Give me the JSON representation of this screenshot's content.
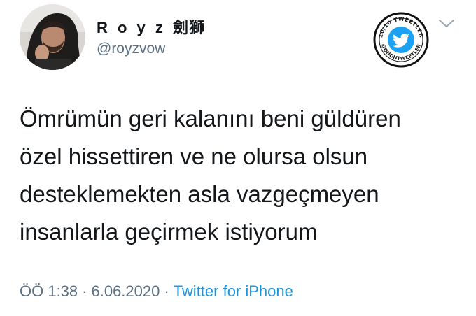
{
  "user": {
    "display_name": "R o y z",
    "display_name_suffix": "劍獅",
    "handle": "@royzvow"
  },
  "stamp": {
    "top_text": "10/10 TWEETLER",
    "bottom_text": "@ONONTWEETLER",
    "icon": "twitter-bird-icon"
  },
  "menu": {
    "icon": "chevron-down-icon"
  },
  "tweet": {
    "lines": [
      "Ömrümün geri kalanını beni güldüren",
      "özel hissettiren ve ne olursa olsun",
      "desteklemekten asla vazgeçmeyen",
      "insanlarla geçirmek istiyorum"
    ]
  },
  "meta": {
    "time": "ÖÖ 1:38",
    "separator": "·",
    "date": "6.06.2020",
    "source": "Twitter for iPhone"
  },
  "colors": {
    "text": "#14171a",
    "secondary": "#5b7083",
    "link": "#1b95e0",
    "brand": "#1da1f2"
  }
}
